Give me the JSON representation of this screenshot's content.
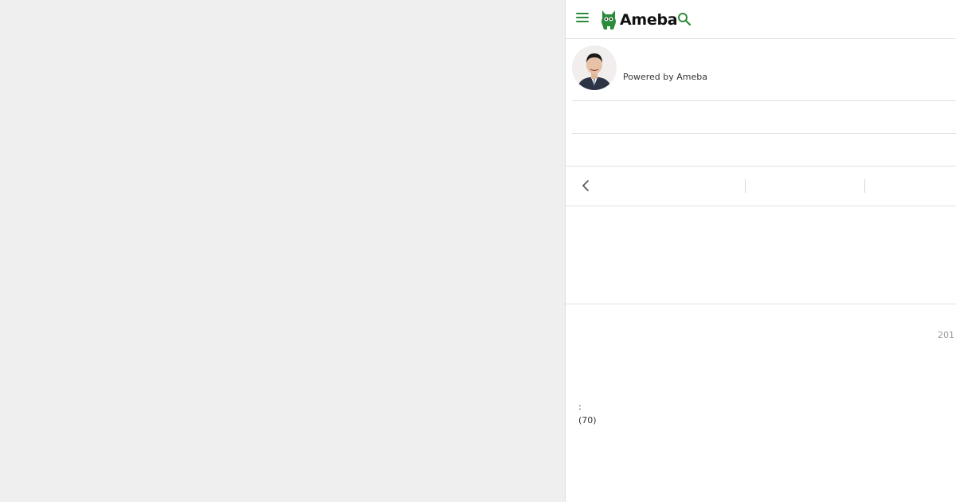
{
  "header": {
    "logo_text": "Ameba",
    "brand_color": "#2d8c3c",
    "icons": [
      "menu-icon",
      "ameba-logo-icon",
      "search-icon"
    ]
  },
  "profile": {
    "powered_by": "Powered by Ameba"
  },
  "nav": {
    "back_icon": "chevron-left-icon"
  },
  "article": {
    "date_partial": "201",
    "separator": ":",
    "count": "(70)"
  }
}
